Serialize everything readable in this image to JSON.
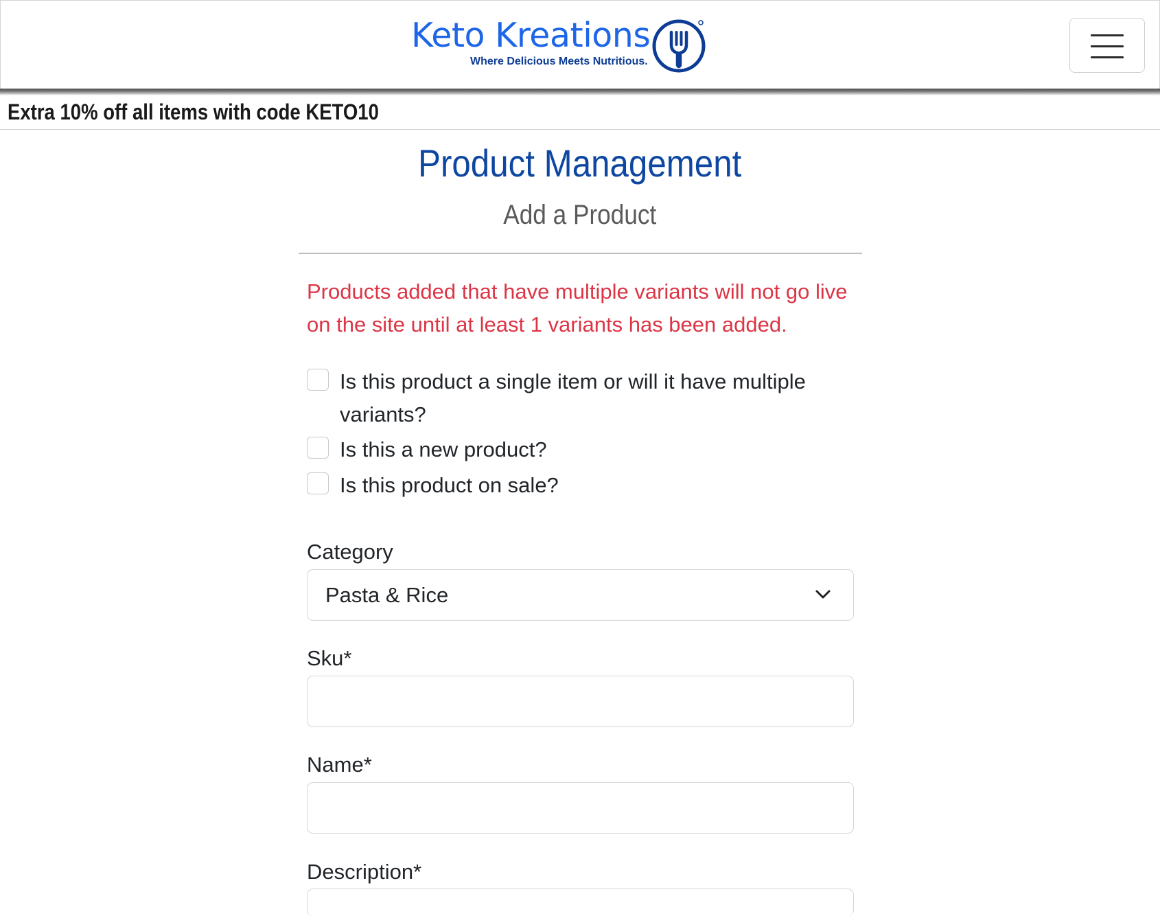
{
  "brand": {
    "name": "Keto Kreations",
    "tagline": "Where Delicious Meets Nutritious."
  },
  "promo": {
    "text": "Extra 10% off all items with code KETO10"
  },
  "page": {
    "title": "Product Management",
    "subtitle": "Add a Product",
    "warning": "Products added that have multiple variants will not go live on the site until at least 1 variants has been added."
  },
  "checkboxes": [
    {
      "label": "Is this product a single item or will it have multiple variants?",
      "checked": false
    },
    {
      "label": "Is this a new product?",
      "checked": false
    },
    {
      "label": "Is this product on sale?",
      "checked": false
    }
  ],
  "form": {
    "category": {
      "label": "Category",
      "value": "Pasta & Rice"
    },
    "sku": {
      "label": "Sku*",
      "value": ""
    },
    "name": {
      "label": "Name*",
      "value": ""
    },
    "description": {
      "label": "Description*"
    }
  },
  "icons": {
    "logo": "fork-in-circle-icon",
    "menu": "hamburger-menu-icon",
    "select": "chevron-down-icon"
  },
  "colors": {
    "brand_blue": "#1e66e8",
    "brand_dark": "#0d3c94",
    "title_blue": "#0d47a1",
    "warning_red": "#dc3545"
  }
}
